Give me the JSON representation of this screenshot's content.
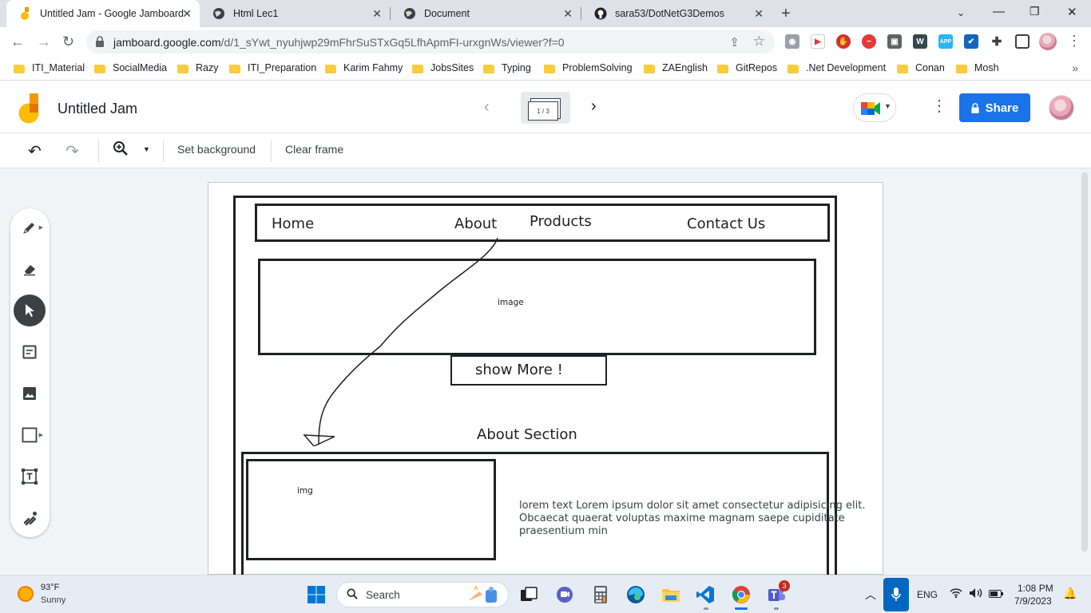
{
  "browser": {
    "tabs": [
      {
        "title": "Untitled Jam - Google Jamboard",
        "icon": "jamboard-icon",
        "active": true
      },
      {
        "title": "Html Lec1",
        "icon": "globe-icon",
        "active": false
      },
      {
        "title": "Document",
        "icon": "globe-icon",
        "active": false
      },
      {
        "title": "sara53/DotNetG3Demos",
        "icon": "github-icon",
        "active": false
      }
    ],
    "url_main": "jamboard.google.com",
    "url_path": "/d/1_sYwt_nyuhjwp29mFhrSuSTxGq5LfhApmFI-urxgnWs/viewer?f=0",
    "bookmarks": [
      "ITI_Material",
      "SocialMedia",
      "Razy",
      "ITI_Preparation",
      "Karim Fahmy",
      "JobsSites",
      "Typing",
      "ProblemSolving",
      "ZAEnglish",
      "GitRepos",
      ".Net Development",
      "Conan",
      "Mosh"
    ]
  },
  "jam": {
    "title": "Untitled Jam",
    "frame_indicator": "1 / 3",
    "share_label": "Share",
    "toolbar": {
      "set_background": "Set background",
      "clear_frame": "Clear frame"
    },
    "canvas": {
      "nav_items": [
        "Home",
        "About",
        "Products",
        "Contact Us"
      ],
      "hero_label": "image",
      "show_more": "show More !",
      "about_heading": "About Section",
      "img_label": "img",
      "lorem_lines": [
        "lorem text  Lorem ipsum dolor sit amet consectetur adipisicing elit.",
        "Obcaecat   quaerat voluptas maxime magnam saepe cupiditate",
        "praesentium min"
      ]
    }
  },
  "taskbar": {
    "temperature": "93°F",
    "condition": "Sunny",
    "search_label": "Search",
    "language": "ENG",
    "time": "1:08 PM",
    "date": "7/9/2023",
    "teams_badge": "3"
  },
  "colors": {
    "share_blue": "#1a73e8",
    "jam_orange": "#f29900",
    "jam_yellow": "#fbbc04",
    "ink": "#202124"
  }
}
